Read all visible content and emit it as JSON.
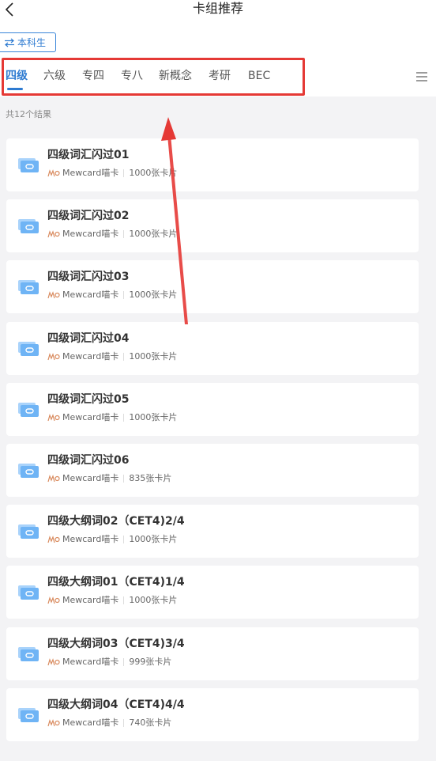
{
  "header": {
    "title": "卡组推荐",
    "switch_label": "本科生"
  },
  "tabs": [
    "四级",
    "六级",
    "专四",
    "专八",
    "新概念",
    "考研",
    "BEC"
  ],
  "active_tab": 0,
  "result_count": "共12个结果",
  "decks": [
    {
      "title": "四级词汇闪过01",
      "brand": "Mewcard喵卡",
      "count": "1000张卡片"
    },
    {
      "title": "四级词汇闪过02",
      "brand": "Mewcard喵卡",
      "count": "1000张卡片"
    },
    {
      "title": "四级词汇闪过03",
      "brand": "Mewcard喵卡",
      "count": "1000张卡片"
    },
    {
      "title": "四级词汇闪过04",
      "brand": "Mewcard喵卡",
      "count": "1000张卡片"
    },
    {
      "title": "四级词汇闪过05",
      "brand": "Mewcard喵卡",
      "count": "1000张卡片"
    },
    {
      "title": "四级词汇闪过06",
      "brand": "Mewcard喵卡",
      "count": "835张卡片"
    },
    {
      "title": "四级大纲词02（CET4)2/4",
      "brand": "Mewcard喵卡",
      "count": "1000张卡片"
    },
    {
      "title": "四级大纲词01（CET4)1/4",
      "brand": "Mewcard喵卡",
      "count": "1000张卡片"
    },
    {
      "title": "四级大纲词03（CET4)3/4",
      "brand": "Mewcard喵卡",
      "count": "999张卡片"
    },
    {
      "title": "四级大纲词04（CET4)4/4",
      "brand": "Mewcard喵卡",
      "count": "740张卡片"
    }
  ],
  "colors": {
    "accent": "#2e7bd1",
    "annotation_red": "#e53935",
    "background": "#f3f3f5",
    "deck_icon": "#6fb4f5"
  },
  "icons": {
    "back": "chevron-left-icon",
    "switch": "swap-arrows-icon",
    "menu": "hamburger-menu-icon",
    "deck": "card-deck-icon",
    "brand": "mewcard-logo"
  }
}
